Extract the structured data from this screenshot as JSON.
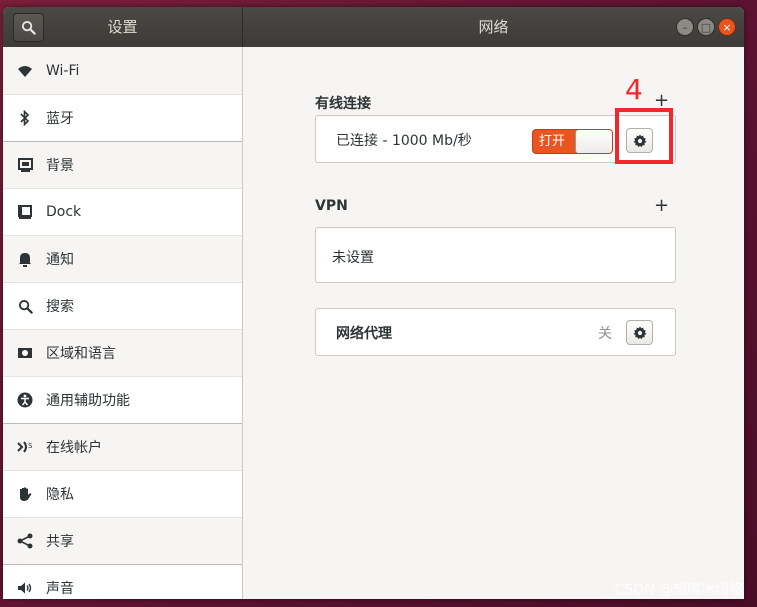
{
  "titlebar": {
    "left_title": "设置",
    "right_title": "网络",
    "controls": {
      "minimize": "–",
      "maximize": "□",
      "close": "×"
    }
  },
  "sidebar": {
    "items": [
      {
        "label": "Wi-Fi",
        "icon": "wifi-icon"
      },
      {
        "label": "蓝牙",
        "icon": "bluetooth-icon"
      },
      {
        "label": "背景",
        "icon": "background-icon"
      },
      {
        "label": "Dock",
        "icon": "dock-icon"
      },
      {
        "label": "通知",
        "icon": "bell-icon"
      },
      {
        "label": "搜索",
        "icon": "search-icon"
      },
      {
        "label": "区域和语言",
        "icon": "region-icon"
      },
      {
        "label": "通用辅助功能",
        "icon": "accessibility-icon"
      },
      {
        "label": "在线帐户",
        "icon": "online-accounts-icon"
      },
      {
        "label": "隐私",
        "icon": "hand-icon"
      },
      {
        "label": "共享",
        "icon": "share-icon"
      },
      {
        "label": "声音",
        "icon": "speaker-icon"
      }
    ]
  },
  "wired": {
    "title": "有线连接",
    "add": "+",
    "status": "已连接 - 1000 Mb/秒",
    "toggle_label": "打开"
  },
  "vpn": {
    "title": "VPN",
    "add": "+",
    "empty": "未设置"
  },
  "proxy": {
    "label": "网络代理",
    "value": "关"
  },
  "annotation": {
    "number": "4",
    "color": "#f2272c"
  },
  "watermark": "CSDN @想喝冰阔骆",
  "colors": {
    "accent": "#e95420",
    "titlebar": "#3c3b37"
  }
}
